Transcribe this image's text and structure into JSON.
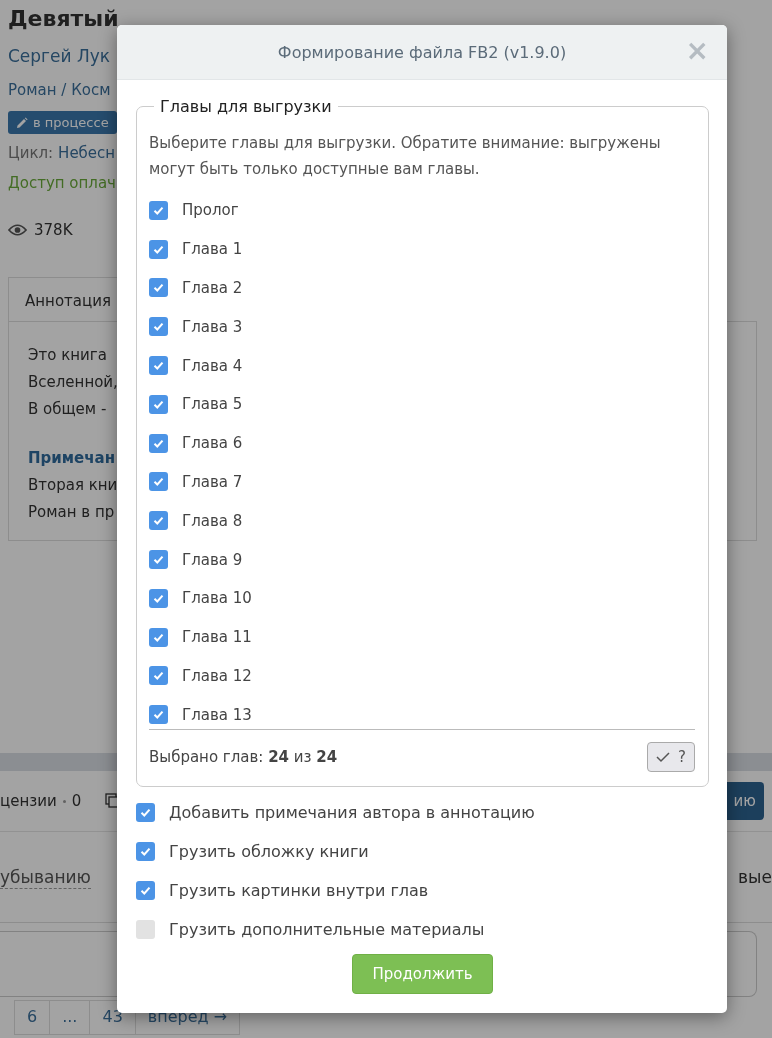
{
  "book": {
    "title": "Девятый",
    "author": "Сергей Лук",
    "genre": "Роман / Косм",
    "status_badge": "в процессе",
    "cycle_label": "Цикл:",
    "cycle_value": "Небесн",
    "access": "Доступ оплач",
    "views": "378K"
  },
  "annotation": {
    "tab": "Аннотация",
    "lines": [
      "Это книга",
      "Вселенной,",
      "В общем -"
    ],
    "note_title": "Примечан",
    "note_lines": [
      "Вторая кни",
      "Роман в пр"
    ]
  },
  "reviews_row": {
    "label": "цензии",
    "count": "0",
    "button": "ию"
  },
  "sort_row": {
    "sort": "убыванию",
    "right": "вые"
  },
  "pagination": [
    "6",
    "...",
    "43",
    "вперед →"
  ],
  "dialog": {
    "title": "Формирование файла FB2 (v1.9.0)",
    "close": "×",
    "fieldset": "Главы для выгрузки",
    "description": "Выберите главы для выгрузки. Обратите внимание: выгружены могут быть только доступные вам главы.",
    "chapters": [
      {
        "label": "Пролог",
        "checked": true
      },
      {
        "label": "Глава 1",
        "checked": true
      },
      {
        "label": "Глава 2",
        "checked": true
      },
      {
        "label": "Глава 3",
        "checked": true
      },
      {
        "label": "Глава 4",
        "checked": true
      },
      {
        "label": "Глава 5",
        "checked": true
      },
      {
        "label": "Глава 6",
        "checked": true
      },
      {
        "label": "Глава 7",
        "checked": true
      },
      {
        "label": "Глава 8",
        "checked": true
      },
      {
        "label": "Глава 9",
        "checked": true
      },
      {
        "label": "Глава 10",
        "checked": true
      },
      {
        "label": "Глава 11",
        "checked": true
      },
      {
        "label": "Глава 12",
        "checked": true
      },
      {
        "label": "Глава 13",
        "checked": true
      }
    ],
    "summary": "Выбрано глав: **24** из **24**",
    "toggle_button": "?",
    "options": [
      {
        "label": "Добавить примечания автора в аннотацию",
        "checked": true
      },
      {
        "label": "Грузить обложку книги",
        "checked": true
      },
      {
        "label": "Грузить картинки внутри глав",
        "checked": true
      },
      {
        "label": "Грузить дополнительные материалы",
        "checked": false
      }
    ],
    "continue_button": "Продолжить"
  }
}
